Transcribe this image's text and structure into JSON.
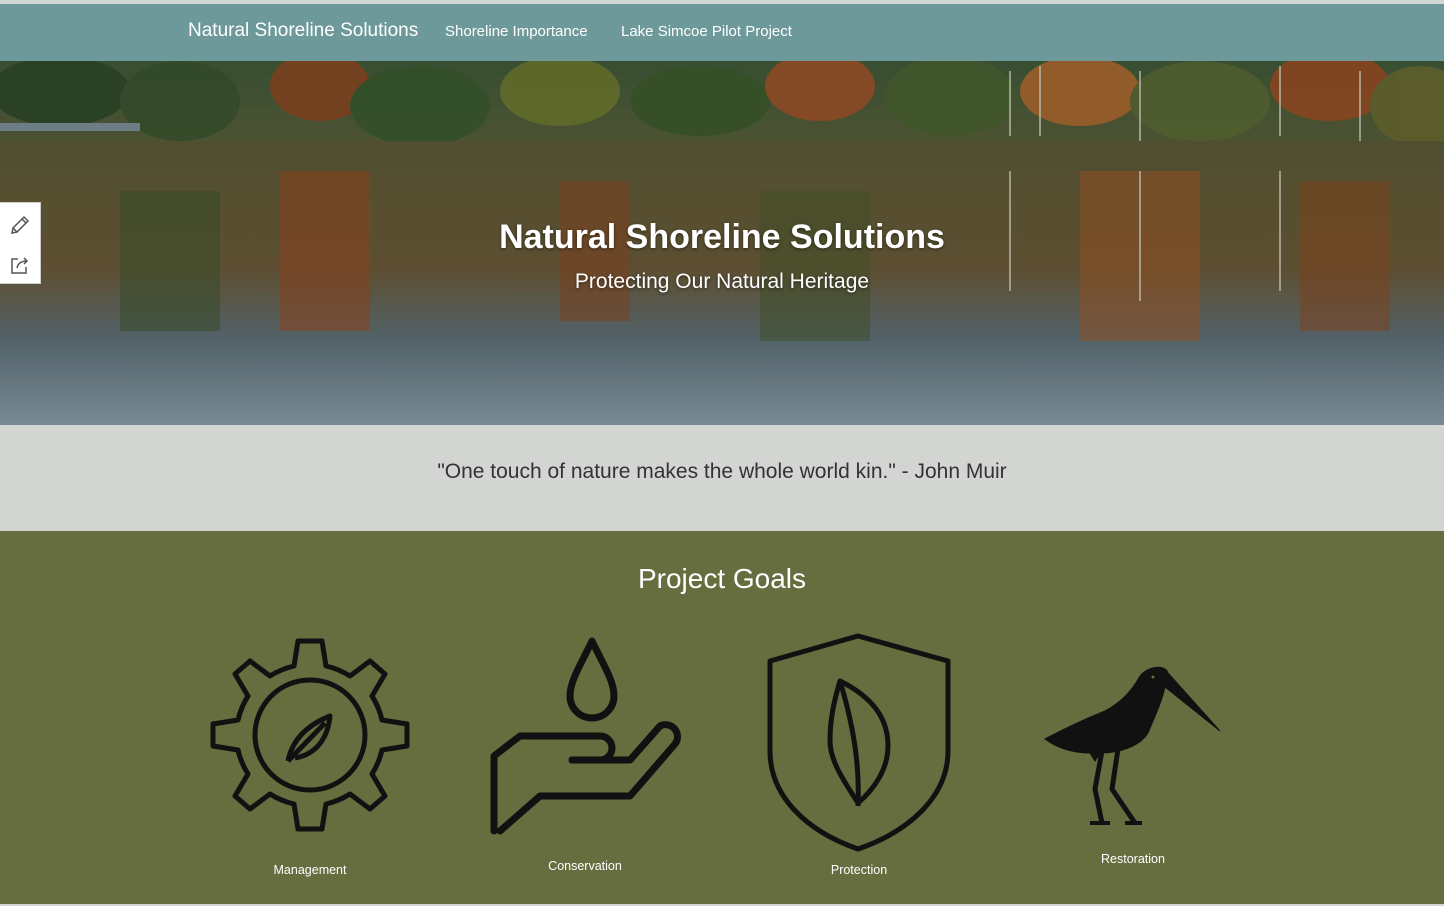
{
  "navbar": {
    "title": "Natural Shoreline Solutions",
    "links": [
      "Shoreline Importance",
      "Lake Simcoe Pilot Project"
    ],
    "color": "#6e999b"
  },
  "hero": {
    "title": "Natural Shoreline Solutions",
    "subtitle": "Protecting Our Natural Heritage"
  },
  "side_tools": {
    "icons": [
      "pencil-icon",
      "share-icon"
    ]
  },
  "quote": {
    "text": "\"One touch of nature makes the whole world kin.\"  -  John Muir"
  },
  "goals": {
    "title": "Project Goals",
    "background": "#666d3f",
    "items": [
      {
        "label": "Management",
        "icon": "gear-leaf-icon"
      },
      {
        "label": "Conservation",
        "icon": "hand-water-drop-icon"
      },
      {
        "label": "Protection",
        "icon": "shield-leaf-icon"
      },
      {
        "label": "Restoration",
        "icon": "shorebird-icon"
      }
    ]
  }
}
